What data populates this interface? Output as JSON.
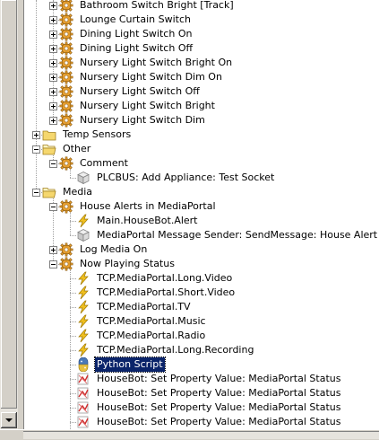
{
  "tree": {
    "rows": [
      {
        "label": "Bathroom Switch Bright [Track]",
        "icon": "gear-icon",
        "expander": "plus",
        "level": 2
      },
      {
        "label": "Lounge Curtain Switch",
        "icon": "gear-icon",
        "expander": "plus",
        "level": 2
      },
      {
        "label": "Dining Light Switch On",
        "icon": "gear-icon",
        "expander": "plus",
        "level": 2
      },
      {
        "label": "Dining Light Switch Off",
        "icon": "gear-icon",
        "expander": "plus",
        "level": 2
      },
      {
        "label": "Nursery Light Switch Bright On",
        "icon": "gear-icon",
        "expander": "plus",
        "level": 2
      },
      {
        "label": "Nursery Light Switch Dim On",
        "icon": "gear-icon",
        "expander": "plus",
        "level": 2
      },
      {
        "label": "Nursery Light Switch Off",
        "icon": "gear-icon",
        "expander": "plus",
        "level": 2
      },
      {
        "label": "Nursery Light Switch Bright",
        "icon": "gear-icon",
        "expander": "plus",
        "level": 2
      },
      {
        "label": "Nursery Light Switch Dim",
        "icon": "gear-icon",
        "expander": "plus",
        "level": 2
      },
      {
        "label": "Temp Sensors",
        "icon": "folder-icon",
        "expander": "plus",
        "level": 1
      },
      {
        "label": "Other",
        "icon": "folder-open-icon",
        "expander": "minus",
        "level": 1
      },
      {
        "label": "Comment",
        "icon": "gear-icon",
        "expander": "minus",
        "level": 2
      },
      {
        "label": "PLCBUS: Add Appliance: Test Socket",
        "icon": "cube-icon",
        "expander": "none",
        "level": 3
      },
      {
        "label": "Media",
        "icon": "folder-open-icon",
        "expander": "minus",
        "level": 1
      },
      {
        "label": "House Alerts in MediaPortal",
        "icon": "gear-icon",
        "expander": "minus",
        "level": 2
      },
      {
        "label": "Main.HouseBot.Alert",
        "icon": "lightning-icon",
        "expander": "none",
        "level": 3
      },
      {
        "label": "MediaPortal Message Sender: SendMessage: House Alert",
        "icon": "cube-icon",
        "expander": "none",
        "level": 3
      },
      {
        "label": "Log Media On",
        "icon": "gear-icon",
        "expander": "plus",
        "level": 2
      },
      {
        "label": "Now Playing Status",
        "icon": "gear-icon",
        "expander": "minus",
        "level": 2
      },
      {
        "label": "TCP.MediaPortal.Long.Video",
        "icon": "lightning-icon",
        "expander": "none",
        "level": 3
      },
      {
        "label": "TCP.MediaPortal.Short.Video",
        "icon": "lightning-icon",
        "expander": "none",
        "level": 3
      },
      {
        "label": "TCP.MediaPortal.TV",
        "icon": "lightning-icon",
        "expander": "none",
        "level": 3
      },
      {
        "label": "TCP.MediaPortal.Music",
        "icon": "lightning-icon",
        "expander": "none",
        "level": 3
      },
      {
        "label": "TCP.MediaPortal.Radio",
        "icon": "lightning-icon",
        "expander": "none",
        "level": 3
      },
      {
        "label": "TCP.MediaPortal.Long.Recording",
        "icon": "lightning-icon",
        "expander": "none",
        "level": 3
      },
      {
        "label": "Python Script",
        "icon": "python-icon",
        "expander": "none",
        "level": 3,
        "selected": true
      },
      {
        "label": "HouseBot: Set Property Value: MediaPortal Status",
        "icon": "property-icon",
        "expander": "none",
        "level": 3
      },
      {
        "label": "HouseBot: Set Property Value: MediaPortal Status",
        "icon": "property-icon",
        "expander": "none",
        "level": 3
      },
      {
        "label": "HouseBot: Set Property Value: MediaPortal Status",
        "icon": "property-icon",
        "expander": "none",
        "level": 3
      },
      {
        "label": "HouseBot: Set Property Value: MediaPortal Status",
        "icon": "property-icon",
        "expander": "none",
        "level": 3
      }
    ]
  },
  "colors": {
    "selection_bg": "#0a246a",
    "selection_fg": "#ffffff",
    "folder": "#f5d76e",
    "gear": "#e8a030",
    "lightning": "#f0c020"
  }
}
